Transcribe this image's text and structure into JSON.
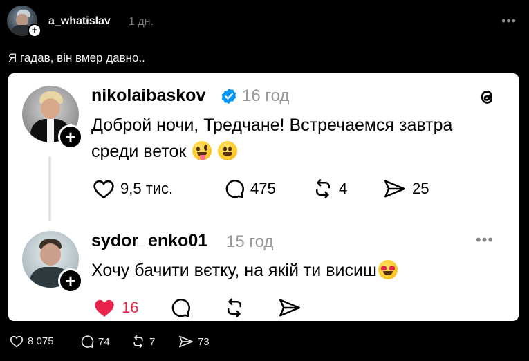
{
  "post": {
    "author": "a_whatislav",
    "time": "1 дн.",
    "caption": "Я гадав, він вмер давно..",
    "stats": {
      "likes": "8 075",
      "comments": "74",
      "reposts": "7",
      "shares": "73"
    }
  },
  "embedded": {
    "original": {
      "author": "nikolaibaskov",
      "time": "16 год",
      "text": "Доброй ночи, Тредчане! Встречаемся завтра среди веток",
      "emojis": [
        "zany-face",
        "grinning-face"
      ],
      "likes": "9,5 тис.",
      "comments": "475",
      "reposts": "4",
      "shares": "25"
    },
    "reply": {
      "author": "sydor_enko01",
      "time": "15 год",
      "text": "Хочу бачити вєтку, на якій ти висиш",
      "emojis": [
        "heart-eyes-face"
      ],
      "likes": "16",
      "liked": true
    }
  },
  "colors": {
    "like_active": "#e8234b",
    "verified": "#0095f6"
  }
}
